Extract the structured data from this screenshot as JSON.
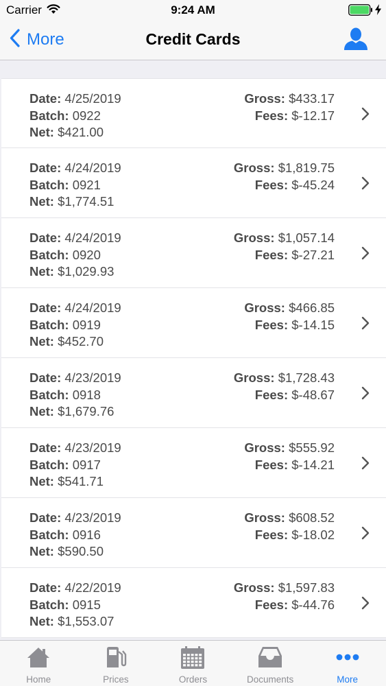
{
  "status_bar": {
    "carrier": "Carrier",
    "time": "9:24 AM"
  },
  "nav": {
    "back_label": "More",
    "title": "Credit Cards"
  },
  "labels": {
    "date": "Date:",
    "batch": "Batch:",
    "net": "Net:",
    "gross": "Gross:",
    "fees": "Fees:"
  },
  "rows": [
    {
      "date": "4/25/2019",
      "batch": "0922",
      "net": "$421.00",
      "gross": "$433.17",
      "fees": "$-12.17"
    },
    {
      "date": "4/24/2019",
      "batch": "0921",
      "net": "$1,774.51",
      "gross": "$1,819.75",
      "fees": "$-45.24"
    },
    {
      "date": "4/24/2019",
      "batch": "0920",
      "net": "$1,029.93",
      "gross": "$1,057.14",
      "fees": "$-27.21"
    },
    {
      "date": "4/24/2019",
      "batch": "0919",
      "net": "$452.70",
      "gross": "$466.85",
      "fees": "$-14.15"
    },
    {
      "date": "4/23/2019",
      "batch": "0918",
      "net": "$1,679.76",
      "gross": "$1,728.43",
      "fees": "$-48.67"
    },
    {
      "date": "4/23/2019",
      "batch": "0917",
      "net": "$541.71",
      "gross": "$555.92",
      "fees": "$-14.21"
    },
    {
      "date": "4/23/2019",
      "batch": "0916",
      "net": "$590.50",
      "gross": "$608.52",
      "fees": "$-18.02"
    },
    {
      "date": "4/22/2019",
      "batch": "0915",
      "net": "$1,553.07",
      "gross": "$1,597.83",
      "fees": "$-44.76"
    }
  ],
  "tabs": [
    {
      "label": "Home",
      "icon": "home-icon",
      "active": false
    },
    {
      "label": "Prices",
      "icon": "fuel-pump-icon",
      "active": false
    },
    {
      "label": "Orders",
      "icon": "calendar-icon",
      "active": false
    },
    {
      "label": "Documents",
      "icon": "inbox-icon",
      "active": false
    },
    {
      "label": "More",
      "icon": "more-dots-icon",
      "active": true
    }
  ],
  "colors": {
    "accent": "#1e7cf2",
    "tab_inactive": "#8e8e93",
    "text": "#4a4a4a",
    "battery": "#4cd964"
  }
}
